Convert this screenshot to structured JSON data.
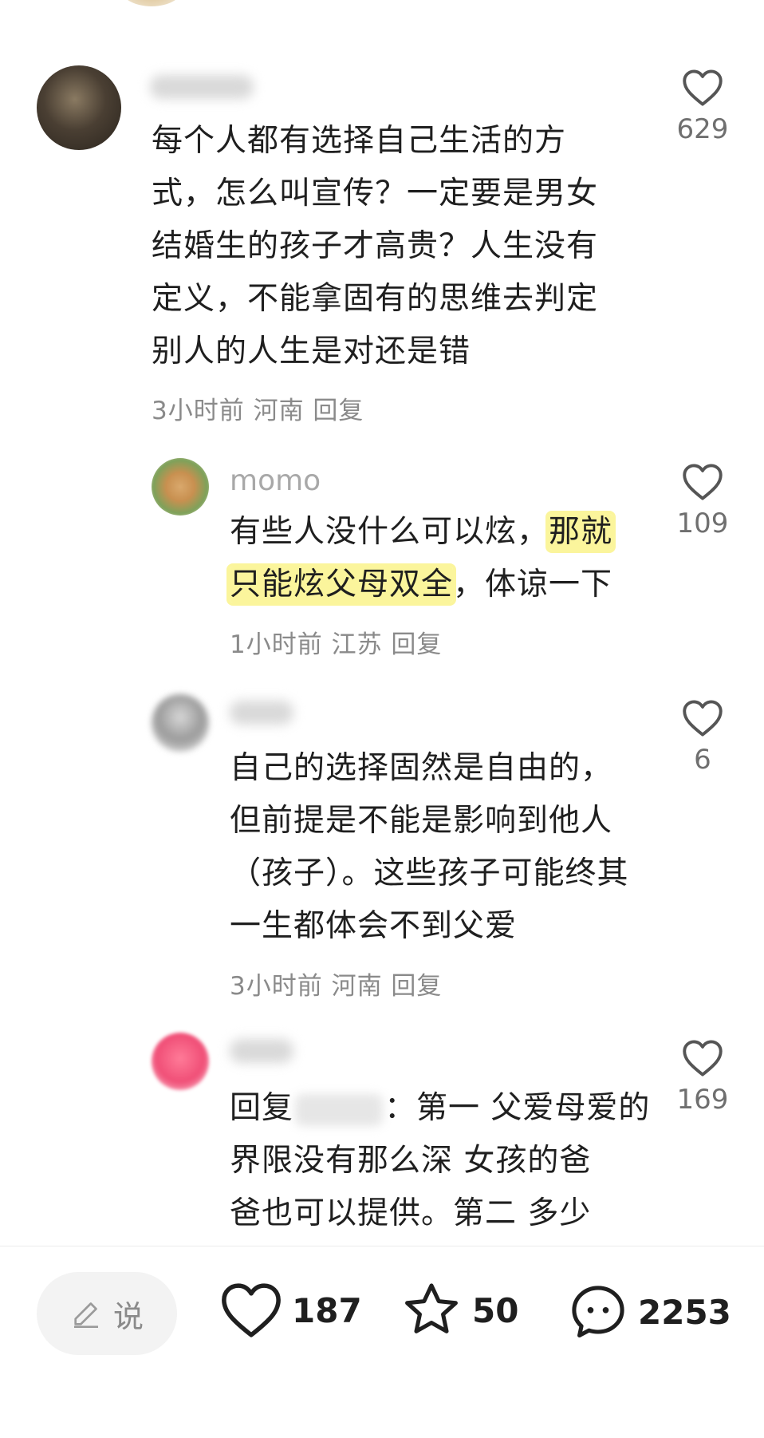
{
  "comments": [
    {
      "text_lines": [
        "每个人都有选择自己生活的方",
        "式，怎么叫宣传？一定要是男女",
        "结婚生的孩子才高贵？人生没有",
        "定义，不能拿固有的思维去判定",
        "别人的人生是对还是错"
      ],
      "meta": "3小时前 河南 回复",
      "likes": "629"
    },
    {
      "username": "momo",
      "line1_pre": "有些人没什么可以炫，",
      "line1_hl": "那就",
      "line2_hl": "只能炫父母双全",
      "line2_post": "，体谅一下",
      "meta": "1小时前 江苏 回复",
      "likes": "109"
    },
    {
      "text_lines": [
        "自己的选择固然是自由的，",
        "但前提是不能是影响到他人",
        "（孩子）。这些孩子可能终其",
        "一生都体会不到父爱"
      ],
      "meta": "3小时前 河南 回复",
      "likes": "6"
    },
    {
      "line1_pre": "回复",
      "line1_post": "：第一 父爱母爱的",
      "text_lines": [
        "界限没有那么深 女孩的爸",
        "爸也可以提供。第二 多少"
      ],
      "likes": "169"
    }
  ],
  "bottom_bar": {
    "say_label": "说",
    "like_count": "187",
    "star_count": "50",
    "comment_count": "2253"
  }
}
